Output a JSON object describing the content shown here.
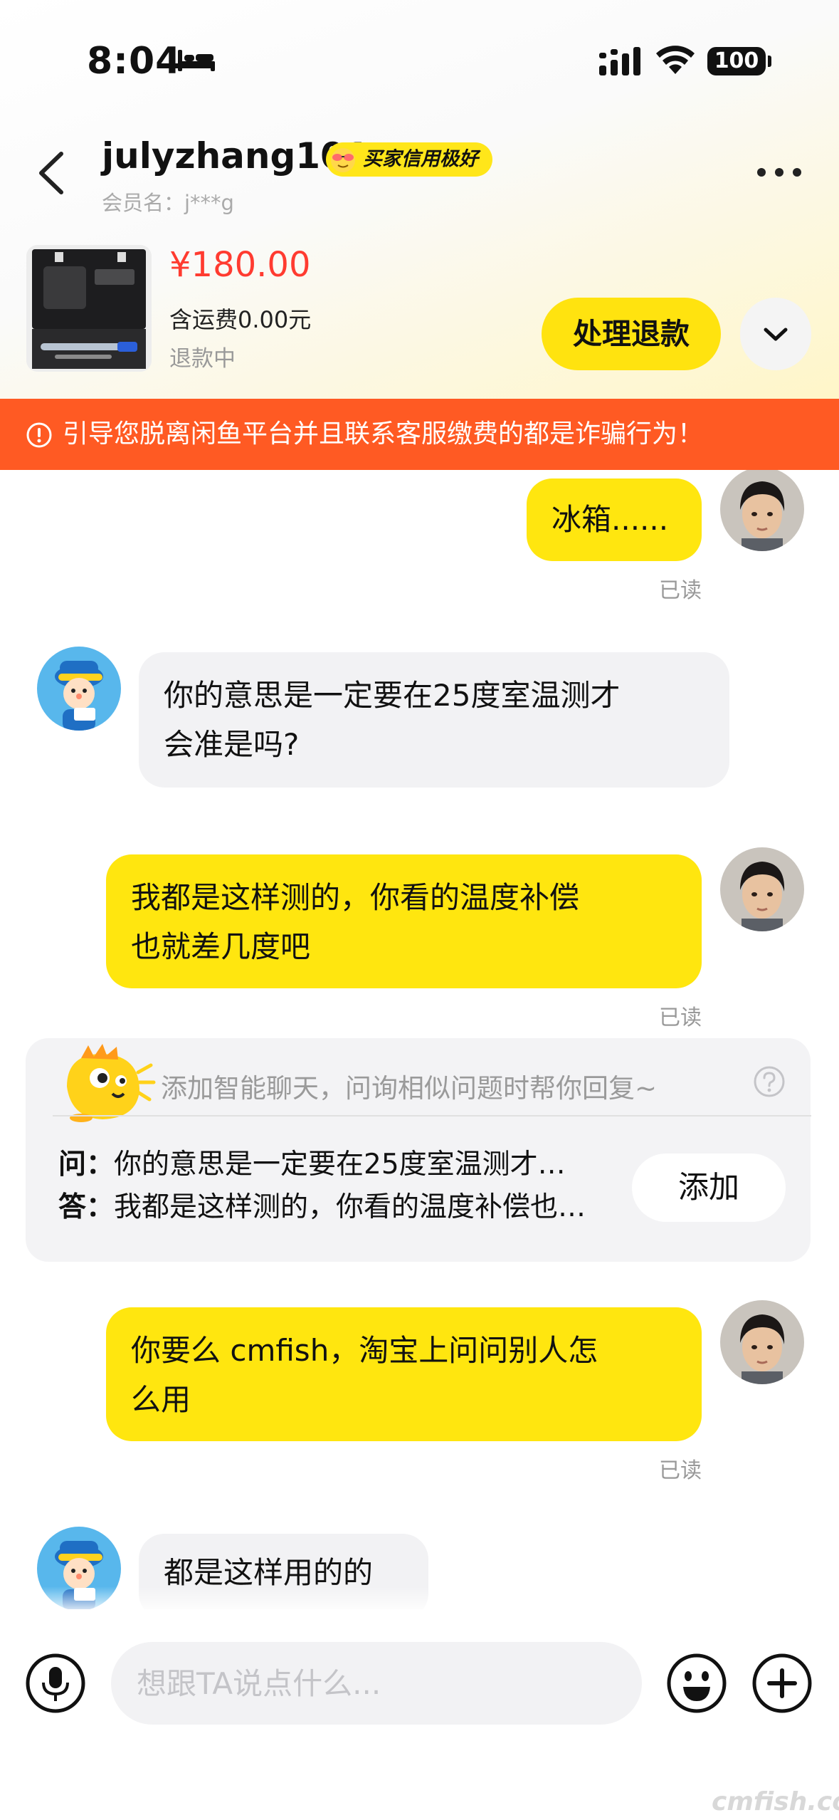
{
  "status_bar": {
    "time": "8:04",
    "battery": "100"
  },
  "header": {
    "nickname": "julyzhang101",
    "credit_badge": "买家信用极好",
    "member_name": "会员名：j***g"
  },
  "product": {
    "price": "¥180.00",
    "shipping": "含运费0.00元",
    "status": "退款中",
    "action_label": "处理退款"
  },
  "warning": {
    "text": "引导您脱离闲鱼平台并且联系客服缴费的都是诈骗行为！"
  },
  "messages": [
    {
      "from": "me",
      "lines": [
        "冰箱......"
      ],
      "read": "已读"
    },
    {
      "from": "other",
      "lines": [
        "你的意思是一定要在25度室温测才",
        "会准是吗?"
      ]
    },
    {
      "from": "me",
      "lines": [
        "我都是这样测的，你看的温度补偿",
        "也就差几度吧"
      ],
      "read": "已读"
    },
    {
      "from": "me",
      "lines": [
        "你要么 cmfish，淘宝上问问别人怎",
        "么用"
      ],
      "read": "已读"
    },
    {
      "from": "other",
      "lines": [
        "都是这样用的的"
      ]
    }
  ],
  "smart_reply": {
    "tip": "添加智能聊天，问询相似问题时帮你回复~",
    "q_key": "问：",
    "q_text": "你的意思是一定要在25度室温测才…",
    "a_key": "答：",
    "a_text": "我都是这样测的，你看的温度补偿也…",
    "add_label": "添加"
  },
  "input": {
    "placeholder": "想跟TA说点什么..."
  },
  "watermark": "cmfish.com",
  "colors": {
    "accent_yellow": "#ffe60f",
    "warning_orange": "#ff5a23",
    "price_red": "#ff3b30"
  }
}
